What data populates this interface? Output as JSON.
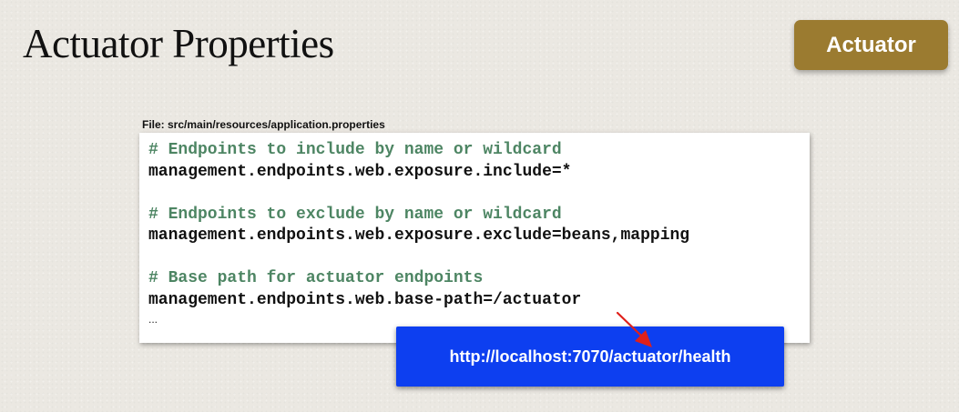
{
  "title": "Actuator Properties",
  "badge": {
    "label": "Actuator",
    "color": "#9b7b30"
  },
  "file_label": "File: src/main/resources/application.properties",
  "code": {
    "comment_color": "#4d8563",
    "lines": [
      "# Endpoints to include by name or wildcard",
      "management.endpoints.web.exposure.include=*",
      "",
      "# Endpoints to exclude by name or wildcard",
      "management.endpoints.web.exposure.exclude=beans,mapping",
      "",
      "# Base path for actuator endpoints",
      "management.endpoints.web.base-path=/actuator",
      "..."
    ]
  },
  "url_box": {
    "text": "http://localhost:7070/actuator/health",
    "color": "#0d3ff0"
  },
  "arrow_color": "#e0201a"
}
